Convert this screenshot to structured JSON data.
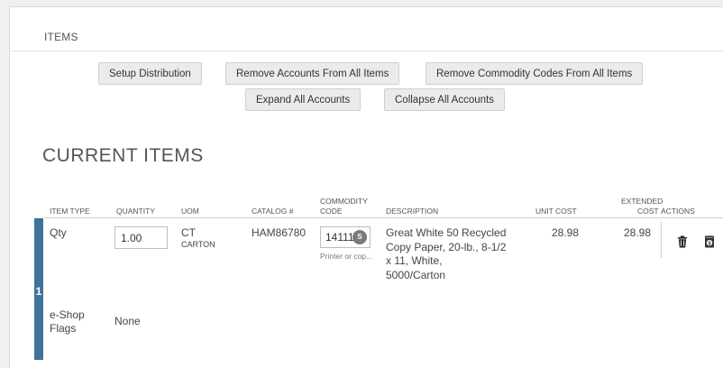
{
  "section": {
    "title": "ITEMS"
  },
  "buttons": {
    "setup_distribution": "Setup Distribution",
    "remove_accounts": "Remove Accounts From All Items",
    "remove_commodity": "Remove Commodity Codes From All Items",
    "expand_accounts": "Expand All Accounts",
    "collapse_accounts": "Collapse All Accounts"
  },
  "current_items": {
    "heading": "CURRENT ITEMS",
    "columns": {
      "item_type": "ITEM TYPE",
      "quantity": "QUANTITY",
      "uom": "UOM",
      "catalog": "CATALOG #",
      "commodity_line1": "COMMODITY",
      "commodity_line2": "CODE",
      "description": "DESCRIPTION",
      "unit_cost": "UNIT COST",
      "extended_line1": "EXTENDED",
      "extended_line2": "COST",
      "actions": "ACTIONS"
    },
    "rows": [
      {
        "number": "1",
        "item_type": "Qty",
        "quantity": "1.00",
        "uom_code": "CT",
        "uom_name": "CARTON",
        "catalog": "HAM86780",
        "commodity_code": "141115",
        "commodity_badge": "S",
        "commodity_hint": "Printer or cop...",
        "description": [
          "Great White 50 Recycled",
          "Copy Paper, 20-lb., 8-1/2",
          "x 11, White,",
          "5000/Carton"
        ],
        "unit_cost": "28.98",
        "extended_cost": "28.98",
        "eshop_label_line1": "e-Shop",
        "eshop_label_line2": "Flags",
        "eshop_value": "None"
      }
    ]
  },
  "icons": {
    "delete": "trash-icon",
    "cost": "dollar-document-icon",
    "badge": "search-badge-icon"
  }
}
